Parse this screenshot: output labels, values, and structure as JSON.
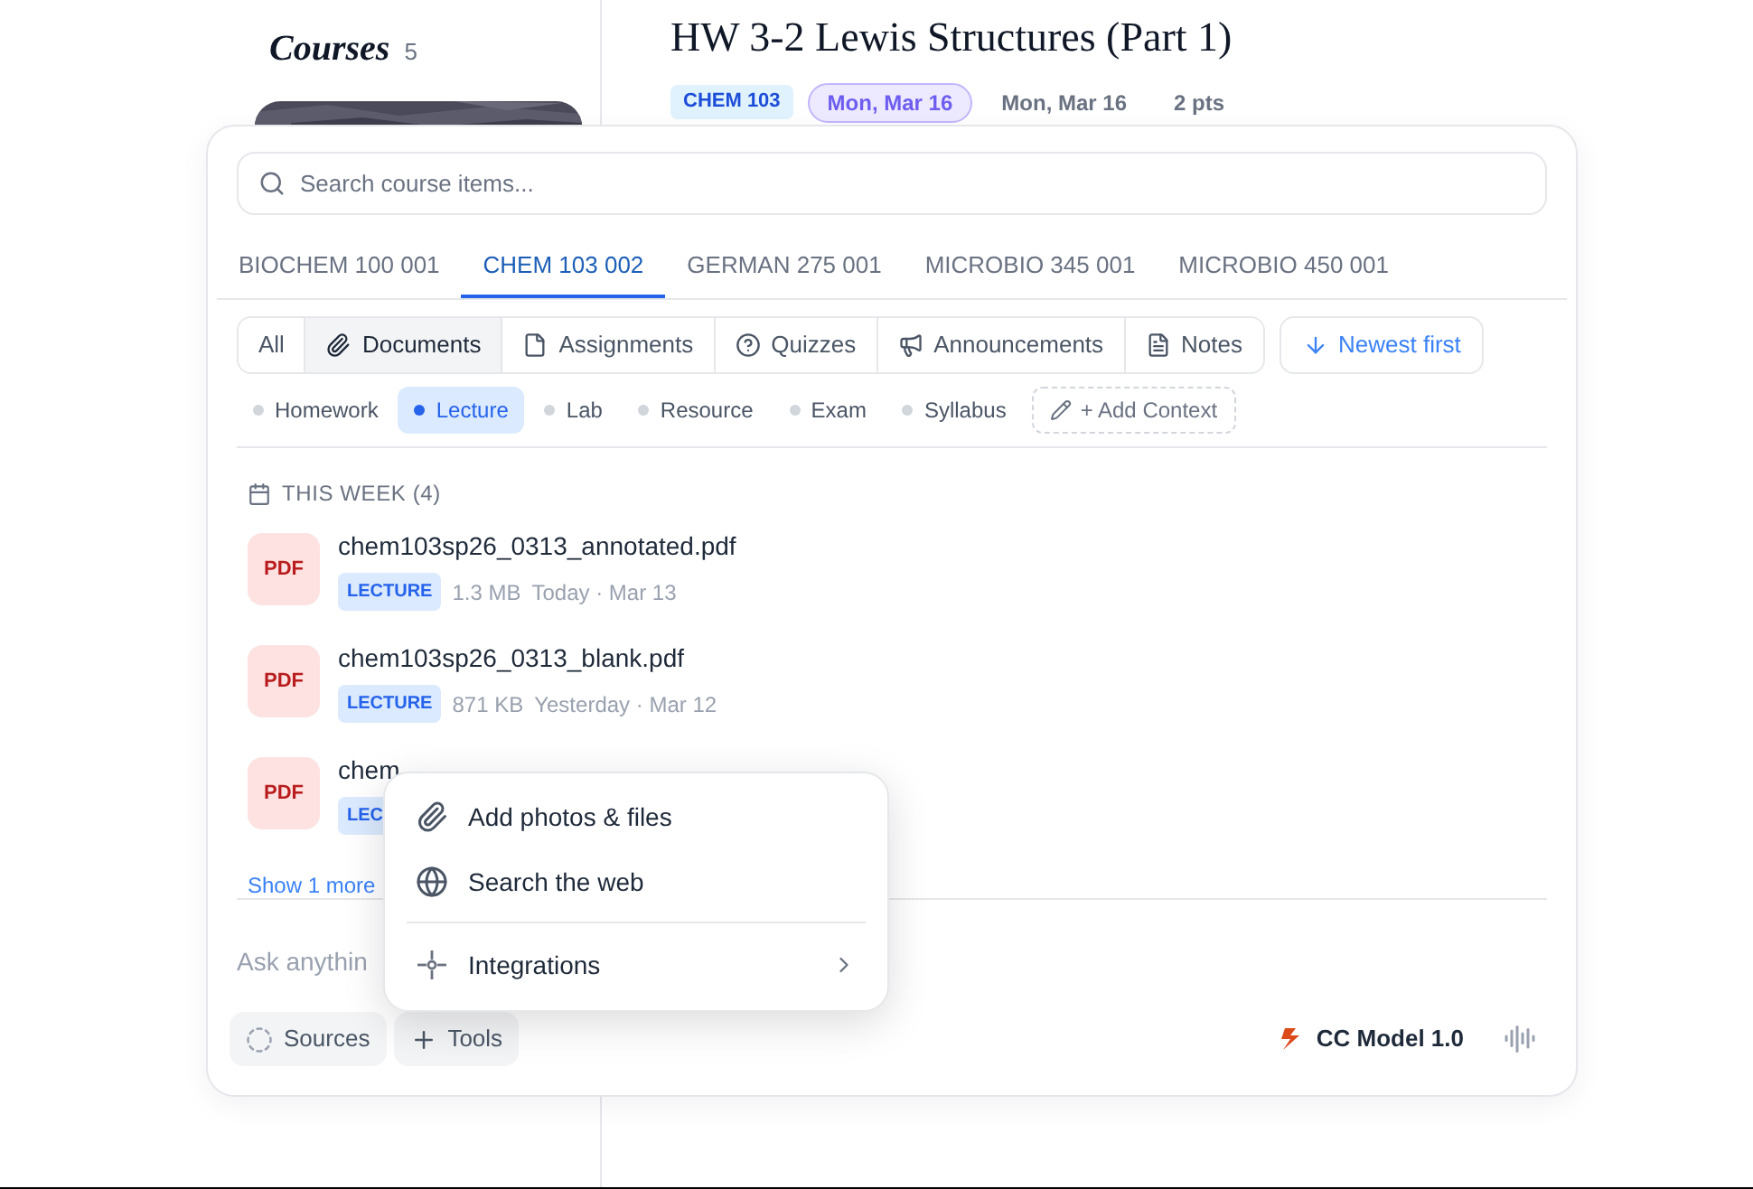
{
  "sidebar": {
    "title": "Courses",
    "count": "5"
  },
  "assignment": {
    "title": "HW 3-2 Lewis Structures (Part 1)",
    "course": "CHEM 103",
    "due": "Mon, Mar 16",
    "date": "Mon, Mar 16",
    "points": "2 pts"
  },
  "panel": {
    "search": {
      "placeholder": "Search course items..."
    },
    "course_tabs": [
      {
        "label": "BIOCHEM 100 001",
        "selected": false
      },
      {
        "label": "CHEM 103 002",
        "selected": true
      },
      {
        "label": "GERMAN 275 001",
        "selected": false
      },
      {
        "label": "MICROBIO 345 001",
        "selected": false
      },
      {
        "label": "MICROBIO 450 001",
        "selected": false
      }
    ],
    "type_filters": [
      {
        "label": "All",
        "selected": false
      },
      {
        "label": "Documents",
        "selected": true
      },
      {
        "label": "Assignments",
        "selected": false
      },
      {
        "label": "Quizzes",
        "selected": false
      },
      {
        "label": "Announcements",
        "selected": false
      },
      {
        "label": "Notes",
        "selected": false
      }
    ],
    "sort": "Newest first",
    "categories": [
      {
        "label": "Homework",
        "selected": false
      },
      {
        "label": "Lecture",
        "selected": true
      },
      {
        "label": "Lab",
        "selected": false
      },
      {
        "label": "Resource",
        "selected": false
      },
      {
        "label": "Exam",
        "selected": false
      },
      {
        "label": "Syllabus",
        "selected": false
      }
    ],
    "add_context": "+ Add Context",
    "section": "THIS WEEK (4)",
    "files": [
      {
        "icon": "PDF",
        "name": "chem103sp26_0313_annotated.pdf",
        "tag": "LECTURE",
        "size": "1.3 MB",
        "date": "Today · Mar 13"
      },
      {
        "icon": "PDF",
        "name": "chem103sp26_0313_blank.pdf",
        "tag": "LECTURE",
        "size": "871 KB",
        "date": "Yesterday · Mar 12"
      },
      {
        "icon": "PDF",
        "name": "chem",
        "tag": "LEC"
      }
    ],
    "show_more": "Show 1 more",
    "composer": {
      "placeholder": "Ask anythin",
      "sources": "Sources",
      "tools": "Tools",
      "model": "CC Model 1.0"
    }
  },
  "tools_menu": [
    {
      "kind": "item",
      "label": "Add photos & files"
    },
    {
      "kind": "item",
      "label": "Search the web"
    },
    {
      "kind": "divider"
    },
    {
      "kind": "submenu",
      "label": "Integrations"
    }
  ]
}
